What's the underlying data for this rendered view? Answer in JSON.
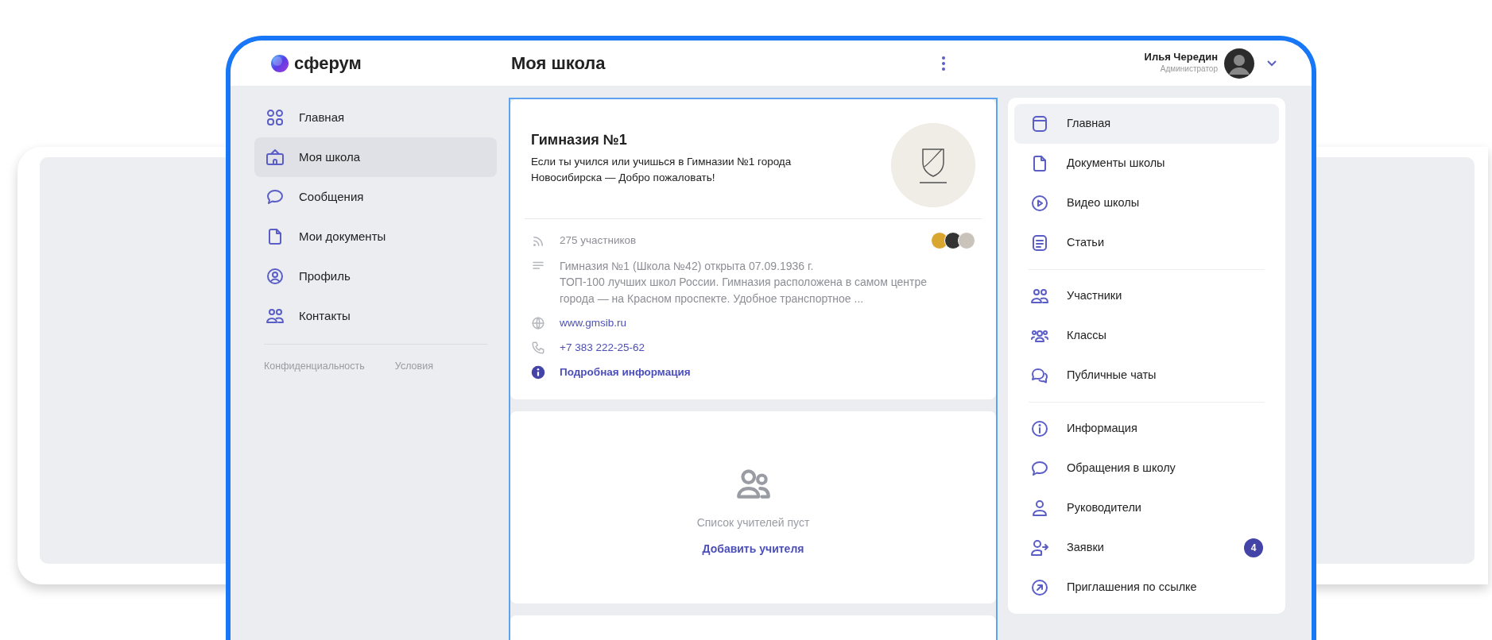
{
  "header": {
    "logo": "сферум",
    "title": "Моя школа",
    "user": {
      "name": "Илья Чередин",
      "role": "Администратор"
    }
  },
  "sidebar": {
    "items": [
      {
        "label": "Главная",
        "selected": false
      },
      {
        "label": "Моя школа",
        "selected": true
      },
      {
        "label": "Сообщения",
        "selected": false
      },
      {
        "label": "Мои документы",
        "selected": false
      },
      {
        "label": "Профиль",
        "selected": false
      },
      {
        "label": "Контакты",
        "selected": false
      }
    ],
    "footer_links": [
      "Конфиденциальность",
      "Условия"
    ]
  },
  "school": {
    "name": "Гимназия №1",
    "tagline": "Если ты учился или учишься в Гимназии №1 города Новосибирска — Добро пожаловать!",
    "members": "275 участников",
    "description": "Гимназия №1 (Школа №42) открыта 07.09.1936 г.\nТОП-100 лучших школ России. Гимназия расположена в самом центре города — на Красном проспекте. Удобное транспортное ...",
    "website": "www.gmsib.ru",
    "phone": "+7 383 222-25-62",
    "more": "Подробная информация"
  },
  "teachers": {
    "empty_text": "Список учителей пуст",
    "action": "Добавить учителя"
  },
  "menu": {
    "groups": [
      [
        {
          "label": "Главная",
          "selected": true
        },
        {
          "label": "Документы школы",
          "selected": false
        },
        {
          "label": "Видео школы",
          "selected": false
        },
        {
          "label": "Статьи",
          "selected": false
        }
      ],
      [
        {
          "label": "Участники",
          "selected": false
        },
        {
          "label": "Классы",
          "selected": false
        },
        {
          "label": "Публичные чаты",
          "selected": false
        }
      ],
      [
        {
          "label": "Информация",
          "selected": false
        },
        {
          "label": "Обращения в школу",
          "selected": false
        },
        {
          "label": "Руководители",
          "selected": false
        },
        {
          "label": "Заявки",
          "selected": false,
          "badge": "4"
        },
        {
          "label": "Приглашения по ссылке",
          "selected": false
        }
      ]
    ]
  }
}
